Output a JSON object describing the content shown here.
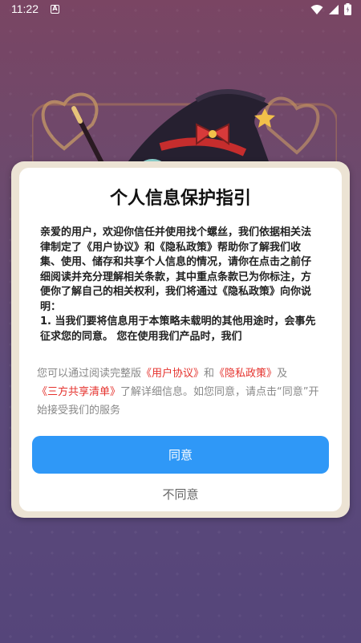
{
  "status_bar": {
    "time": "11:22",
    "notification_icon": "A",
    "icons": [
      "wifi-icon",
      "signal-icon",
      "battery-icon"
    ]
  },
  "dialog": {
    "title": "个人信息保护指引",
    "body": [
      "亲爱的用户，欢迎你信任并使用找个螺丝，我们依据相关法律制定了《用户协议》和《隐私政策》帮助你了解我们收集、使用、储存和共享个人信息的情况，请你在点击之前仔细阅读并充分理解相关条款，其中重点条款已为你标注，方便你了解自己的相关权利，我们将通过《隐私政策》向你说明：",
      "1. 当我们要将信息用于本策略未载明的其他用途时，会事先征求您的同意。 您在使用我们产品时，我们"
    ],
    "note": {
      "prefix": "您可以通过阅读完整版",
      "link_user_agreement": "《用户协议》",
      "and": "和",
      "link_privacy_policy": "《隐私政策》",
      "and2": "及",
      "link_third_party": "《三方共享清单》",
      "suffix": "了解详细信息。如您同意，请点击“同意”开始接受我们的服务"
    },
    "agree_label": "同意",
    "disagree_label": "不同意"
  },
  "colors": {
    "accent": "#2f98f7",
    "link": "#e5322d",
    "frame": "#ece3d4"
  }
}
